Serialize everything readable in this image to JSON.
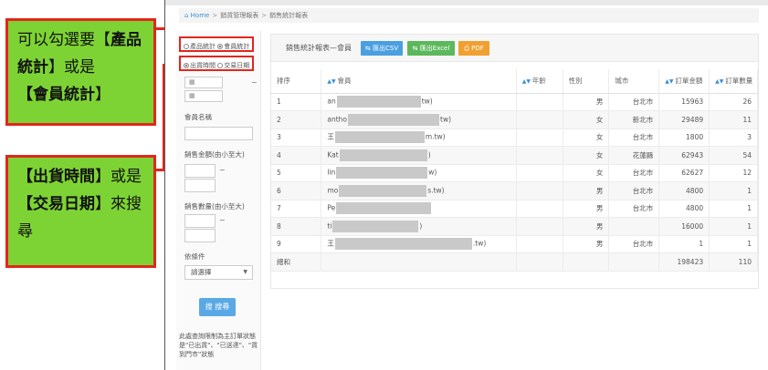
{
  "callouts": {
    "box1": {
      "pre": "可以勾選要【",
      "b1": "產品統計",
      "mid": "】或是",
      "b2": "【會員統計",
      "post": "】"
    },
    "box2": {
      "b1": "【出貨時間",
      "mid": "】或是",
      "b2": "【交易日期",
      "post": "】來搜尋"
    }
  },
  "breadcrumb": {
    "home": "Home",
    "sep": ">",
    "crumb2": "銷貨管理報表",
    "crumb3": "銷售統計報表"
  },
  "filters": {
    "radio_group1": {
      "opt1": "產品統計",
      "opt2": "會員統計"
    },
    "radio_group2": {
      "opt1": "出貨時間",
      "opt2": "交易日期"
    },
    "date_icon": "calendar-icon",
    "date_from": "▦",
    "date_to": "▦",
    "tilde": "~",
    "member_name_label": "會員名稱",
    "amount_label": "銷售金額(由小至大)",
    "qty_label": "銷售數量(由小至大)",
    "condition_label": "依條件",
    "condition_select": "請選擇",
    "search_button": "搜 搜尋",
    "note": "此處查詢限制為主訂單狀態是\"已出貨\"、\"已送達\"、\"貨到門市\"狀態"
  },
  "panel": {
    "title": "銷售統計報表—會員",
    "btn_csv": "匯出CSV",
    "btn_excel": "匯出Excel",
    "btn_pdf": "PDF"
  },
  "table": {
    "headers": [
      "排序",
      "會員",
      "年齡",
      "性別",
      "城市",
      "訂單金額",
      "訂單數量"
    ],
    "rows": [
      {
        "rank": "1",
        "m_pre": "an",
        "m_post": "tw)",
        "age": "",
        "gender": "男",
        "city": "台北市",
        "amount": "15963",
        "qty": "26"
      },
      {
        "rank": "2",
        "m_pre": "antho",
        "m_post": "tw)",
        "age": "",
        "gender": "女",
        "city": "新北市",
        "amount": "29489",
        "qty": "11"
      },
      {
        "rank": "3",
        "m_pre": "王",
        "m_post": "m.tw)",
        "age": "",
        "gender": "女",
        "city": "台北市",
        "amount": "1800",
        "qty": "3"
      },
      {
        "rank": "4",
        "m_pre": "Kat",
        "m_post": ")",
        "age": "",
        "gender": "女",
        "city": "花蓮縣",
        "amount": "62943",
        "qty": "54"
      },
      {
        "rank": "5",
        "m_pre": "lin",
        "m_post": "w)",
        "age": "",
        "gender": "女",
        "city": "台北市",
        "amount": "62627",
        "qty": "12"
      },
      {
        "rank": "6",
        "m_pre": "mo",
        "m_post": "s.tw)",
        "age": "",
        "gender": "男",
        "city": "台北市",
        "amount": "4800",
        "qty": "1"
      },
      {
        "rank": "7",
        "m_pre": "Pe",
        "m_post": "",
        "age": "",
        "gender": "男",
        "city": "台北市",
        "amount": "4800",
        "qty": "1"
      },
      {
        "rank": "8",
        "m_pre": "ti",
        "m_post": ")",
        "age": "",
        "gender": "男",
        "city": "",
        "amount": "16000",
        "qty": "1"
      },
      {
        "rank": "9",
        "m_pre": "王",
        "m_post": ".tw)",
        "age": "",
        "gender": "男",
        "city": "台北市",
        "amount": "1",
        "qty": "1"
      }
    ],
    "total": {
      "label": "總和",
      "amount": "198423",
      "qty": "110"
    }
  },
  "colors": {
    "callout_bg": "#7ed334",
    "callout_border": "#e2261d",
    "csv": "#4a9fe0",
    "excel": "#5cb85c",
    "pdf": "#f0a030",
    "search": "#5aa9e6"
  }
}
